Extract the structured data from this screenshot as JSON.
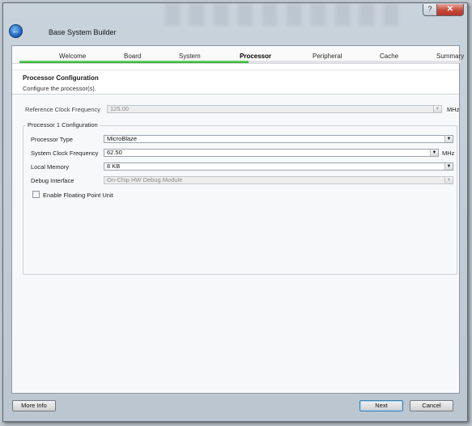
{
  "window": {
    "title": "Base System Builder",
    "help_label": "?",
    "close_label": "✕",
    "back_icon": "arrow-left-icon"
  },
  "steps": [
    {
      "label": "Welcome"
    },
    {
      "label": "Board"
    },
    {
      "label": "System"
    },
    {
      "label": "Processor"
    },
    {
      "label": "Peripheral"
    },
    {
      "label": "Cache"
    },
    {
      "label": "Summary"
    }
  ],
  "progress": {
    "value_fraction": 0.52,
    "color": "#2aa52b"
  },
  "header": {
    "title": "Processor Configuration",
    "subtitle": "Configure the processor(s)."
  },
  "form": {
    "ref_clock": {
      "label": "Reference Clock Frequency",
      "value": "125.00",
      "unit": "MHz"
    },
    "group_title": "Processor 1 Configuration",
    "processor_type": {
      "label": "Processor Type",
      "value": "MicroBlaze"
    },
    "system_clock": {
      "label": "System Clock Frequency",
      "value": "62.50",
      "unit": "MHz"
    },
    "local_memory": {
      "label": "Local Memory",
      "value": "8 KB"
    },
    "debug_interface": {
      "label": "Debug Interface",
      "value": "On-Chip HW Debug Module"
    },
    "fpu": {
      "label": "Enable Floating Point Unit",
      "checked": false
    }
  },
  "footer": {
    "more_info_label": "More Info",
    "next_label": "Next",
    "cancel_label": "Cancel"
  }
}
